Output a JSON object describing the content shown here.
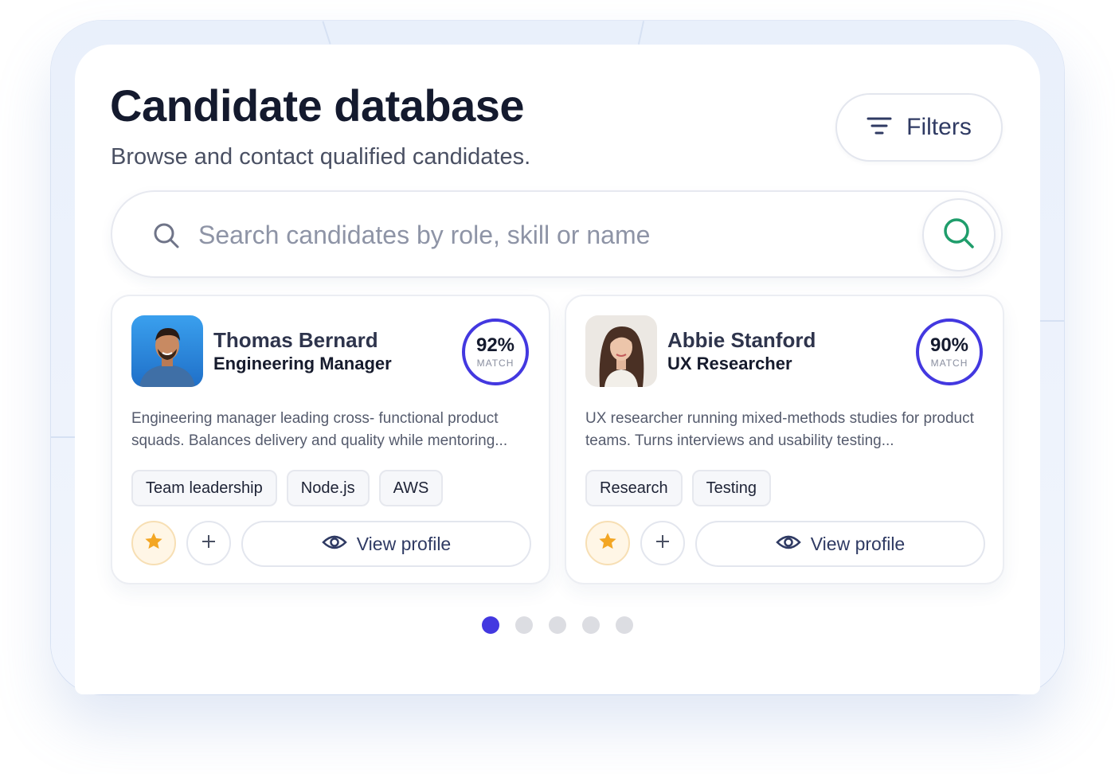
{
  "header": {
    "title": "Candidate database",
    "subtitle": "Browse and contact qualified candidates.",
    "filters_label": "Filters"
  },
  "search": {
    "placeholder": "Search candidates by role, skill or name",
    "value": ""
  },
  "candidates": [
    {
      "name": "Thomas Bernard",
      "role": "Engineering Manager",
      "match_percent": "92%",
      "match_label": "MATCH",
      "description": "Engineering manager leading cross- functional product squads. Balances delivery and quality while mentoring...",
      "skills": [
        "Team leadership",
        "Node.js",
        "AWS"
      ],
      "view_label": "View profile"
    },
    {
      "name": "Abbie Stanford",
      "role": "UX Researcher",
      "match_percent": "90%",
      "match_label": "MATCH",
      "description": "UX researcher running mixed-methods studies for product teams. Turns interviews and usability testing...",
      "skills": [
        "Research",
        "Testing"
      ],
      "view_label": "View profile"
    }
  ],
  "pagination": {
    "total": 5,
    "active_index": 0
  },
  "icons": {
    "filters": "filter-lines-icon",
    "search": "search-icon",
    "star": "star-icon",
    "add": "plus-icon",
    "view": "eye-icon"
  },
  "colors": {
    "accent": "#4338e0",
    "search_go": "#1f9d6b",
    "star": "#f3a623",
    "title": "#141a2e"
  }
}
